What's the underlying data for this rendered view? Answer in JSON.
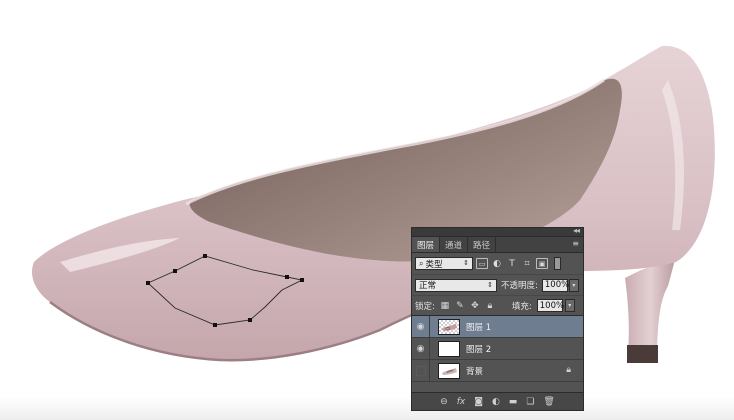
{
  "panel": {
    "tabs": [
      {
        "label": "图层"
      },
      {
        "label": "通道"
      },
      {
        "label": "路径"
      }
    ],
    "filter": {
      "kind": "类型"
    },
    "blend_mode": "正常",
    "opacity_label": "不透明度:",
    "opacity_value": "100%",
    "lock_label": "锁定:",
    "fill_label": "填充:",
    "fill_value": "100%",
    "layers": [
      {
        "name": "图层 1",
        "visible": true,
        "selected": true
      },
      {
        "name": "图层 2",
        "visible": true,
        "selected": false
      },
      {
        "name": "背景",
        "visible": false,
        "selected": false,
        "locked": true
      }
    ]
  },
  "colors": {
    "shoe": "#d9c2c6",
    "shoe_shadow": "#b99ba0",
    "lining": "#8c7670",
    "path_stroke": "#2a2a2a",
    "panel_bg": "#535353",
    "selected_layer": "#6f7d91"
  },
  "icons": {
    "filter": [
      "image-filter-icon",
      "adjustment-filter-icon",
      "type-filter-icon",
      "shape-filter-icon",
      "smart-object-filter-icon"
    ],
    "lock": [
      "lock-transparent-icon",
      "lock-image-icon",
      "lock-position-icon",
      "lock-all-icon"
    ],
    "footer": [
      "link-icon",
      "fx-icon",
      "mask-icon",
      "adjustment-icon",
      "folder-icon",
      "new-layer-icon",
      "trash-icon"
    ]
  }
}
